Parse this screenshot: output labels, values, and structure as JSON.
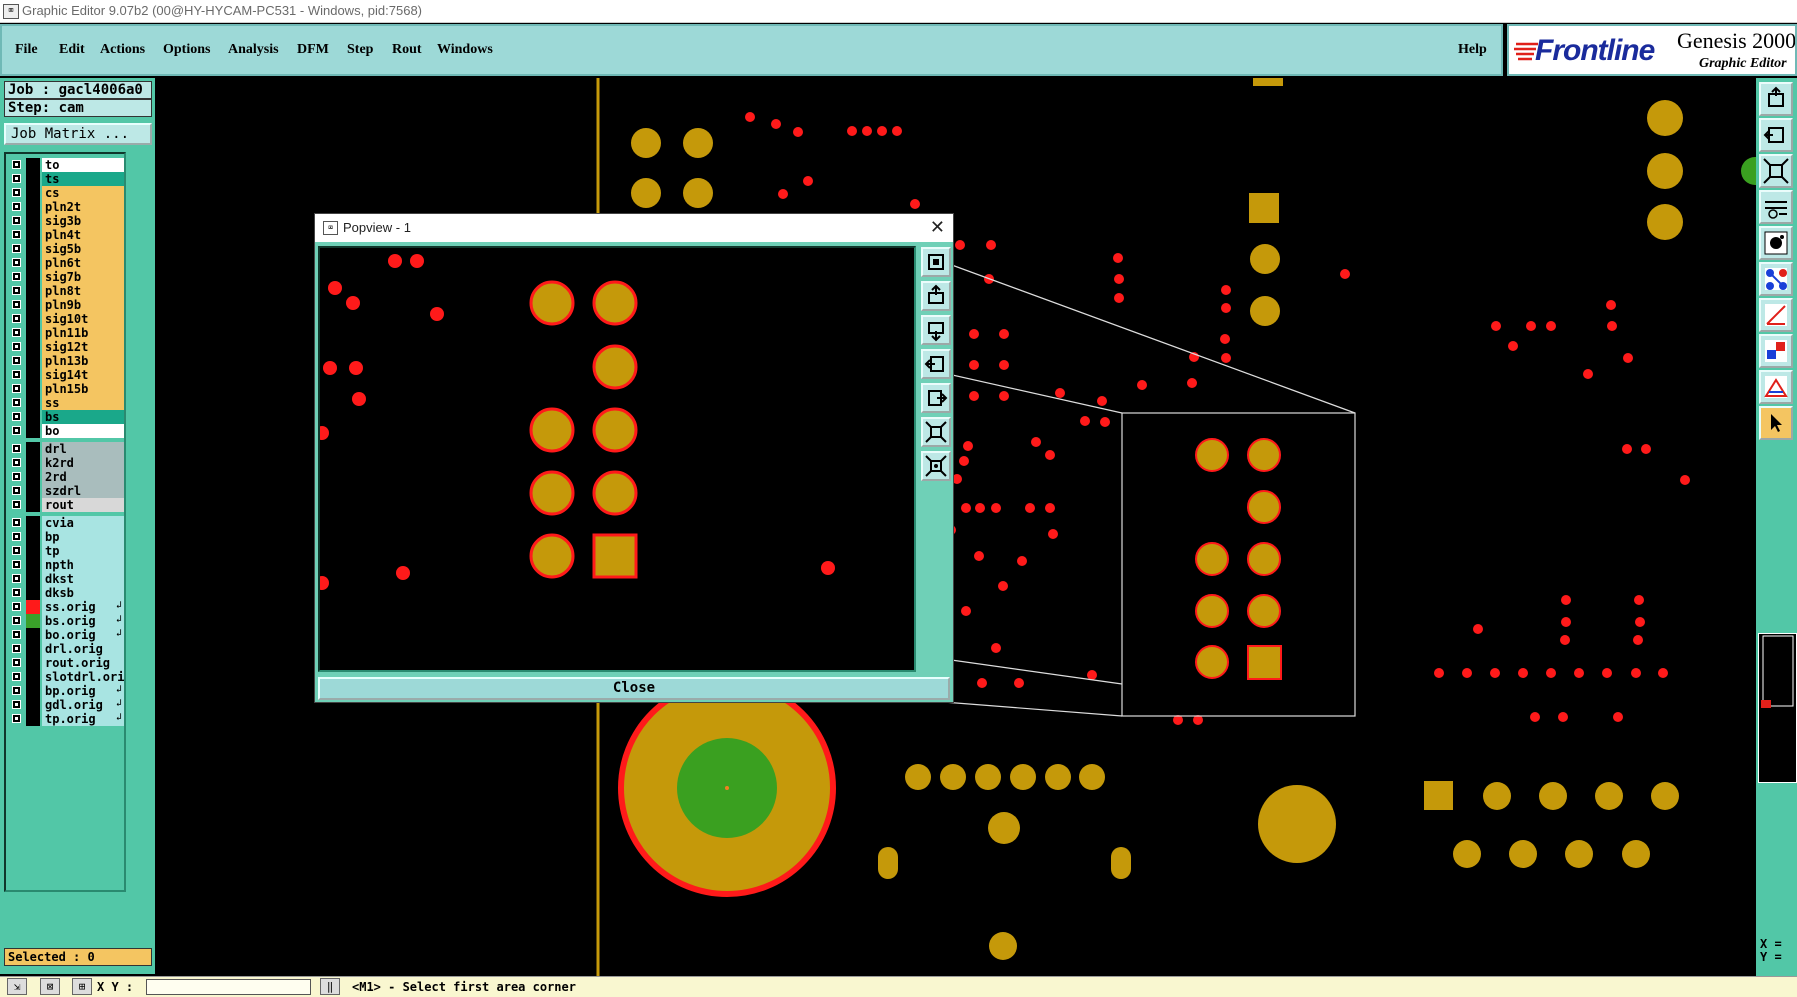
{
  "window": {
    "title": "Graphic Editor 9.07b2 (00@HY-HYCAM-PC531 - Windows, pid:7568)"
  },
  "menu": {
    "items": [
      {
        "label": "File"
      },
      {
        "label": "Edit"
      },
      {
        "label": "Actions"
      },
      {
        "label": "Options"
      },
      {
        "label": "Analysis"
      },
      {
        "label": "DFM"
      },
      {
        "label": "Step"
      },
      {
        "label": "Rout"
      },
      {
        "label": "Windows"
      }
    ],
    "help": "Help"
  },
  "brand": {
    "logo": "Frontline",
    "product": "Genesis 2000",
    "subtitle": "Graphic Editor"
  },
  "job": {
    "job_label": "Job : gacl4006a0",
    "step_label": "Step: cam",
    "matrix_button": "Job Matrix ..."
  },
  "layers": [
    {
      "name": "to",
      "color": "#ffffff",
      "group": 0
    },
    {
      "name": "ts",
      "color": "#1aa88a",
      "group": 0
    },
    {
      "name": "cs",
      "color": "#f4c561",
      "group": 0
    },
    {
      "name": "pln2t",
      "color": "#f4c561",
      "group": 0
    },
    {
      "name": "sig3b",
      "color": "#f4c561",
      "group": 0
    },
    {
      "name": "pln4t",
      "color": "#f4c561",
      "group": 0
    },
    {
      "name": "sig5b",
      "color": "#f4c561",
      "group": 0
    },
    {
      "name": "pln6t",
      "color": "#f4c561",
      "group": 0
    },
    {
      "name": "sig7b",
      "color": "#f4c561",
      "group": 0
    },
    {
      "name": "pln8t",
      "color": "#f4c561",
      "group": 0
    },
    {
      "name": "pln9b",
      "color": "#f4c561",
      "group": 0
    },
    {
      "name": "sig10t",
      "color": "#f4c561",
      "group": 0
    },
    {
      "name": "pln11b",
      "color": "#f4c561",
      "group": 0
    },
    {
      "name": "sig12t",
      "color": "#f4c561",
      "group": 0
    },
    {
      "name": "pln13b",
      "color": "#f4c561",
      "group": 0
    },
    {
      "name": "sig14t",
      "color": "#f4c561",
      "group": 0
    },
    {
      "name": "pln15b",
      "color": "#f4c561",
      "group": 0
    },
    {
      "name": "ss",
      "color": "#f4c561",
      "group": 0
    },
    {
      "name": "bs",
      "color": "#1aa88a",
      "group": 0
    },
    {
      "name": "bo",
      "color": "#ffffff",
      "group": 0
    },
    {
      "name": "drl",
      "color": "#a9bdbd",
      "group": 1
    },
    {
      "name": "k2rd",
      "color": "#a9bdbd",
      "group": 1
    },
    {
      "name": "2rd",
      "color": "#a9bdbd",
      "group": 1
    },
    {
      "name": "szdrl",
      "color": "#a9bdbd",
      "group": 1
    },
    {
      "name": "rout",
      "color": "#d8d8d8",
      "group": 1
    },
    {
      "name": "cvia",
      "color": "#a8e4e2",
      "group": 2
    },
    {
      "name": "bp",
      "color": "#a8e4e2",
      "group": 2
    },
    {
      "name": "tp",
      "color": "#a8e4e2",
      "group": 2
    },
    {
      "name": "npth",
      "color": "#a8e4e2",
      "group": 2
    },
    {
      "name": "dkst",
      "color": "#a8e4e2",
      "group": 2
    },
    {
      "name": "dksb",
      "color": "#a8e4e2",
      "group": 2
    },
    {
      "name": "ss.orig",
      "color": "#a8e4e2",
      "group": 2,
      "swatch": "#ff1a1a",
      "flag": "↲"
    },
    {
      "name": "bs.orig",
      "color": "#a8e4e2",
      "group": 2,
      "swatch": "#3aa02a",
      "flag": "↲"
    },
    {
      "name": "bo.orig",
      "color": "#a8e4e2",
      "group": 2,
      "flag": "↲"
    },
    {
      "name": "drl.orig",
      "color": "#a8e4e2",
      "group": 2
    },
    {
      "name": "rout.orig",
      "color": "#a8e4e2",
      "group": 2
    },
    {
      "name": "slotdrl.orig",
      "color": "#a8e4e2",
      "group": 2
    },
    {
      "name": "bp.orig",
      "color": "#a8e4e2",
      "group": 2,
      "flag": "↲"
    },
    {
      "name": "gdl.orig",
      "color": "#a8e4e2",
      "group": 2,
      "flag": "↲"
    },
    {
      "name": "tp.orig",
      "color": "#a8e4e2",
      "group": 2,
      "flag": "↲"
    }
  ],
  "selected": "Selected : 0",
  "popview": {
    "title": "Popview - 1",
    "close_label": "Close",
    "close_x": "✕"
  },
  "status": {
    "coord_label": "X Y :",
    "message": "<M1> - Select first area corner",
    "xy_readout": "X =\nY ="
  },
  "colors": {
    "pad": "#c5990a",
    "pad_outline": "#ff1a1a",
    "via": "#ff1a1a",
    "fill": "#3aa020",
    "ui_teal": "#52c7a7"
  }
}
